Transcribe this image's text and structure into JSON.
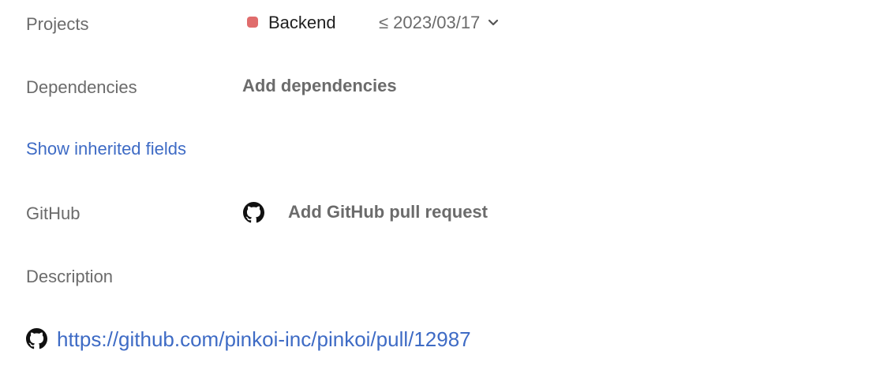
{
  "fields": {
    "projects": {
      "label": "Projects",
      "project_name": "Backend",
      "project_color": "#e06c6c",
      "milestone": "≤ 2023/03/17"
    },
    "dependencies": {
      "label": "Dependencies",
      "action": "Add dependencies"
    },
    "show_inherited": "Show inherited fields",
    "github": {
      "label": "GitHub",
      "action": "Add GitHub pull request",
      "icon": "github-icon"
    },
    "description": {
      "label": "Description",
      "link": "https://github.com/pinkoi-inc/pinkoi/pull/12987"
    }
  },
  "colors": {
    "link": "#3e6bc5",
    "muted": "#6b6b6b"
  }
}
